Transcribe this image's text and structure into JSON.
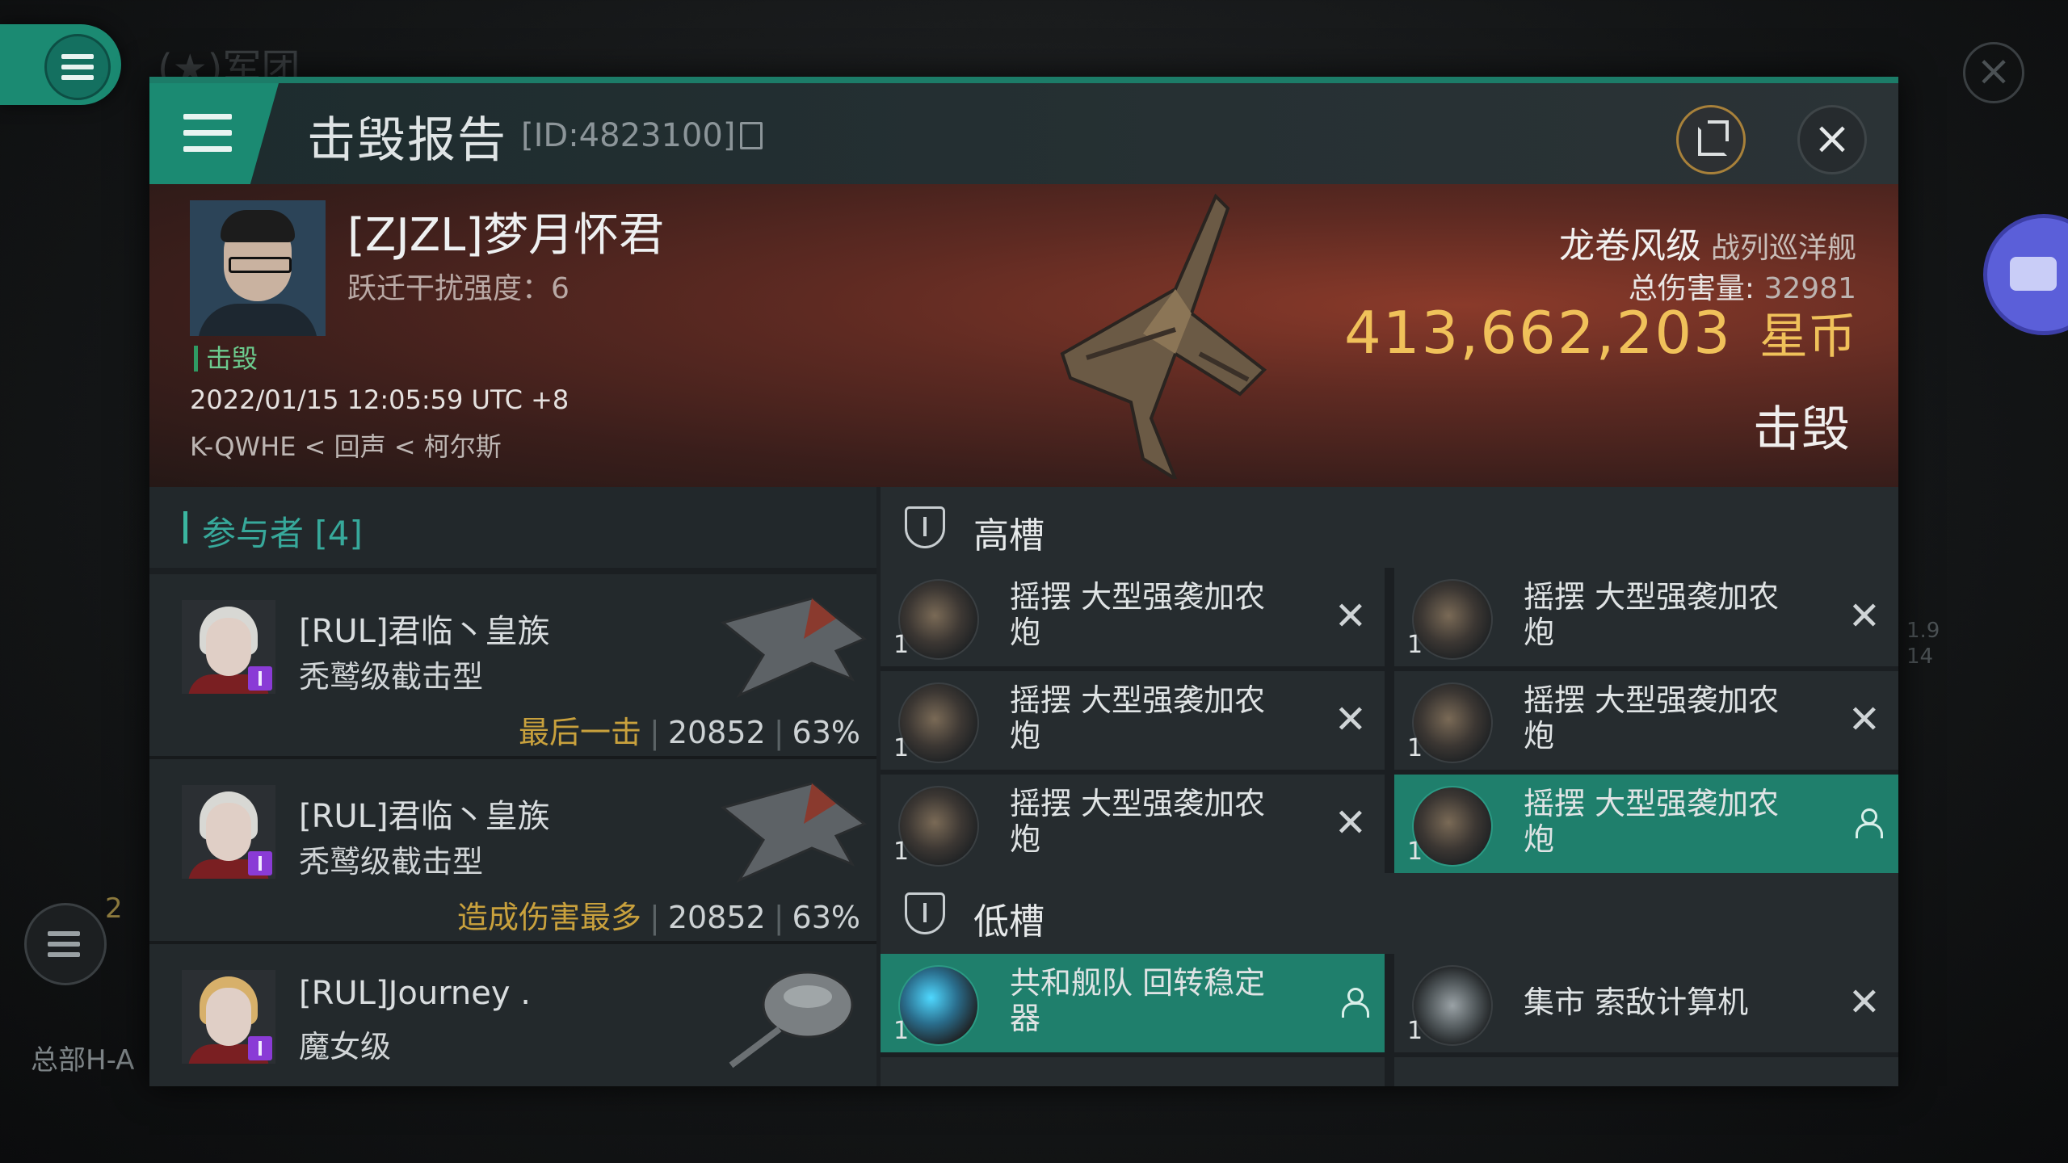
{
  "background": {
    "ghost_title": "(★)军团",
    "badge_count": "2",
    "hq_label": "总部H-A",
    "right_numbers": [
      "1.9",
      "14"
    ]
  },
  "header": {
    "title": "击毁报告",
    "id_label": "[ID:4823100]"
  },
  "victim": {
    "name": "[ZJZL]梦月怀君",
    "warp_label": "跃迁干扰强度：6",
    "status_tag": "击毁",
    "time": "2022/01/15 12:05:59 UTC +8",
    "location": "K-QWHE < 回声 < 柯尔斯",
    "ship_name": "龙卷风级",
    "ship_class": "战列巡洋舰",
    "total_damage_label": "总伤害量:",
    "total_damage_value": "32981",
    "isk_value": "413,662,203",
    "isk_unit": "星币",
    "result": "击毁"
  },
  "participants": {
    "header": "参与者 [4]",
    "items": [
      {
        "name": "[RUL]君临丶皇族",
        "ship": "秃鹫级截击型",
        "tag": "最后一击",
        "damage": "20852",
        "percent": "63%"
      },
      {
        "name": "[RUL]君临丶皇族",
        "ship": "秃鹫级截击型",
        "tag": "造成伤害最多",
        "damage": "20852",
        "percent": "63%"
      },
      {
        "name": "[RUL]Journey .",
        "ship": "魔女级",
        "tag": "",
        "damage": "",
        "percent": ""
      }
    ]
  },
  "slots": {
    "high": {
      "label": "高槽",
      "modules": [
        {
          "name": "摇摆 大型强袭加农炮",
          "qty": "1",
          "state": "destroyed"
        },
        {
          "name": "摇摆 大型强袭加农炮",
          "qty": "1",
          "state": "destroyed"
        },
        {
          "name": "摇摆 大型强袭加农炮",
          "qty": "1",
          "state": "destroyed"
        },
        {
          "name": "摇摆 大型强袭加农炮",
          "qty": "1",
          "state": "destroyed"
        },
        {
          "name": "摇摆 大型强袭加农炮",
          "qty": "1",
          "state": "destroyed"
        },
        {
          "name": "摇摆 大型强袭加农炮",
          "qty": "1",
          "state": "dropped"
        }
      ]
    },
    "low": {
      "label": "低槽",
      "modules": [
        {
          "name": "共和舰队 回转稳定器",
          "qty": "1",
          "state": "dropped"
        },
        {
          "name": "集市 索敌计算机",
          "qty": "1",
          "state": "destroyed"
        }
      ]
    }
  },
  "colors": {
    "accent": "#1b8a72",
    "isk_gold": "#f0c15a",
    "tag_gold": "#c9a13d",
    "camera": "#5b5fd9"
  }
}
